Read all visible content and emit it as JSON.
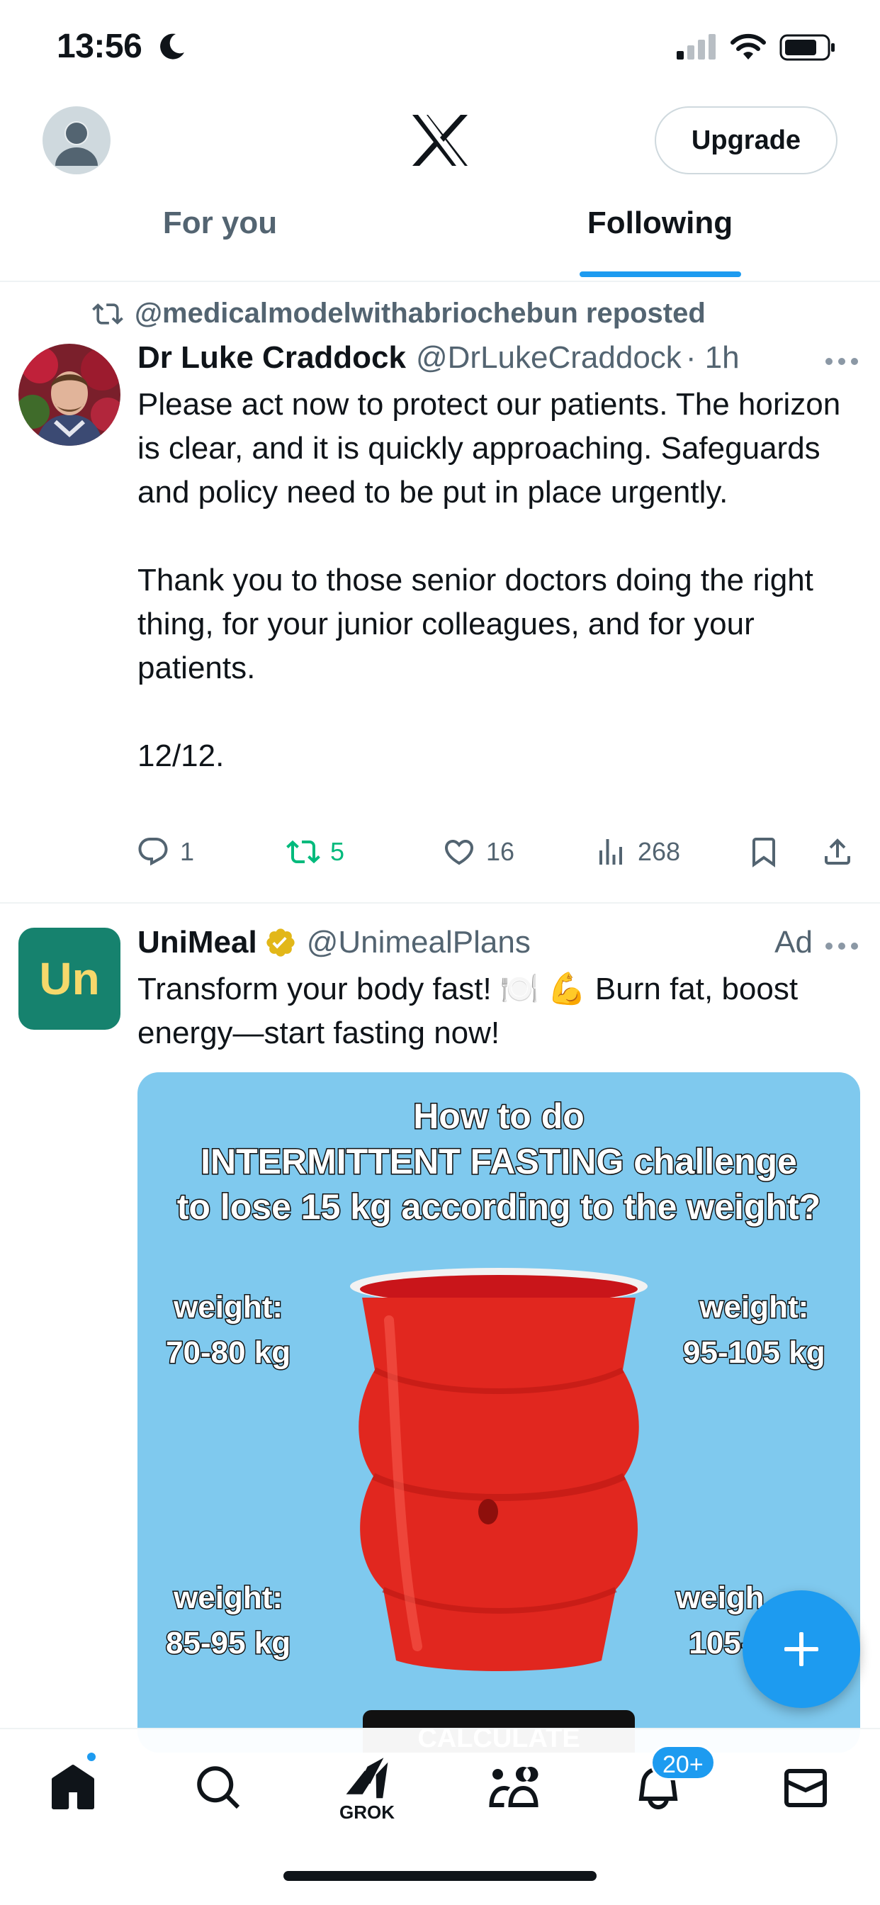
{
  "status_bar": {
    "time": "13:56",
    "icons": [
      "moon-icon",
      "signal-icon",
      "wifi-icon",
      "battery-icon"
    ]
  },
  "header": {
    "logo": "x-logo",
    "upgrade_label": "Upgrade",
    "tabs": [
      {
        "label": "For you",
        "active": false
      },
      {
        "label": "Following",
        "active": true
      }
    ]
  },
  "feed": {
    "tweets": [
      {
        "repost_by": "@medicalmodelwithabriochebun reposted",
        "name": "Dr Luke Craddock",
        "handle": "@DrLukeCraddock",
        "time": "· 1h",
        "text": "Please act now to protect our patients. The horizon is clear, and it is quickly approaching. Safeguards and policy need to be put in place urgently.\n\nThank you to those senior doctors doing the right thing, for your junior colleagues, and for your patients.\n\n12/12.",
        "replies": "1",
        "reposts": "5",
        "likes": "16",
        "views": "268"
      },
      {
        "name": "UniMeal",
        "handle": "@UnimealPlans",
        "ad_label": "Ad",
        "text": "Transform your body fast! 🍽️ 💪 Burn fat, boost energy—start fasting now!",
        "avatar_text": "Un",
        "image": {
          "headline": "How to do\nINTERMITTENT FASTING challenge\nto lose 15 kg according to the weight?",
          "weights": [
            "weight:\n70-80 kg",
            "weight:\n95-105 kg",
            "weight:\n85-95 kg",
            "weigh\n105-"
          ],
          "button": "CALCULATE"
        }
      }
    ]
  },
  "bottom_nav": {
    "grok_label": "GROK",
    "notif_badge": "20+"
  },
  "colors": {
    "accent": "#1d9bf0",
    "retweet": "#00ba7c",
    "secondary_text": "#536471",
    "unimeal_green": "#16826e"
  }
}
